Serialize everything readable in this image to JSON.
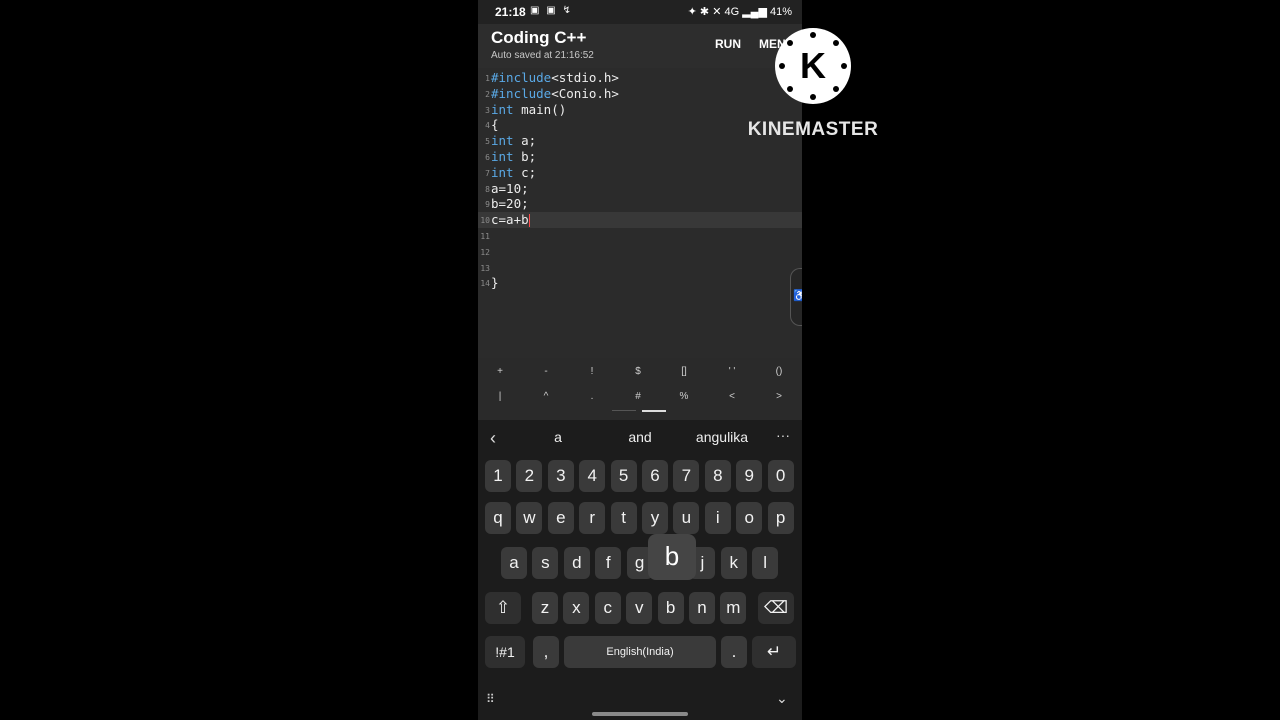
{
  "status": {
    "time": "21:18",
    "left_icons": "▣ ▣ ↯",
    "right_text": "✦ ✱ ✕ 4G ▂▄▆ 41%"
  },
  "app": {
    "title": "Coding C++",
    "autosave": "Auto saved at 21:16:52",
    "run_label": "RUN",
    "menu_label": "MENU"
  },
  "editor": {
    "lines": [
      {
        "num": "1",
        "kw": "#include",
        "text": "<stdio.h>"
      },
      {
        "num": "2",
        "kw": "#include",
        "text": "<Conio.h>"
      },
      {
        "num": "3",
        "kw": "int",
        "text": " main()"
      },
      {
        "num": "4",
        "kw": "",
        "text": "{"
      },
      {
        "num": "5",
        "kw": "int",
        "text": " a;"
      },
      {
        "num": "6",
        "kw": "int",
        "text": " b;"
      },
      {
        "num": "7",
        "kw": "int",
        "text": " c;"
      },
      {
        "num": "8",
        "kw": "",
        "text": "a=10;"
      },
      {
        "num": "9",
        "kw": "",
        "text": "b=20;"
      },
      {
        "num": "10",
        "kw": "",
        "text": "c=a+b"
      },
      {
        "num": "11",
        "kw": "",
        "text": ""
      },
      {
        "num": "12",
        "kw": "",
        "text": ""
      },
      {
        "num": "13",
        "kw": "",
        "text": ""
      },
      {
        "num": "14",
        "kw": "",
        "text": "}"
      }
    ]
  },
  "symbols": {
    "row1": [
      "+",
      "-",
      "!",
      "$",
      "[]",
      "' '",
      "()"
    ],
    "row2": [
      "|",
      "^",
      ".",
      "#",
      "%",
      "<",
      ">"
    ]
  },
  "keyboard": {
    "suggestions": [
      "a",
      "and",
      "angulika"
    ],
    "numbers": [
      "1",
      "2",
      "3",
      "4",
      "5",
      "6",
      "7",
      "8",
      "9",
      "0"
    ],
    "row1": [
      "q",
      "w",
      "e",
      "r",
      "t",
      "y",
      "u",
      "i",
      "o",
      "p"
    ],
    "row2": [
      "a",
      "s",
      "d",
      "f",
      "g",
      "h",
      "j",
      "k",
      "l"
    ],
    "row3": [
      "z",
      "x",
      "c",
      "v",
      "b",
      "n",
      "m"
    ],
    "sym_label": "!#1",
    "comma": ",",
    "space_label": "English(India)",
    "period": ".",
    "popup_key": "b"
  },
  "icons": {
    "back": "‹",
    "more": "···",
    "shift": "⇧",
    "backspace": "⌫",
    "enter": "↵",
    "grid": "⠿",
    "hide": "⌄",
    "accessibility": "♿"
  },
  "watermark": {
    "letter": "K",
    "text": "KINEMASTER"
  }
}
